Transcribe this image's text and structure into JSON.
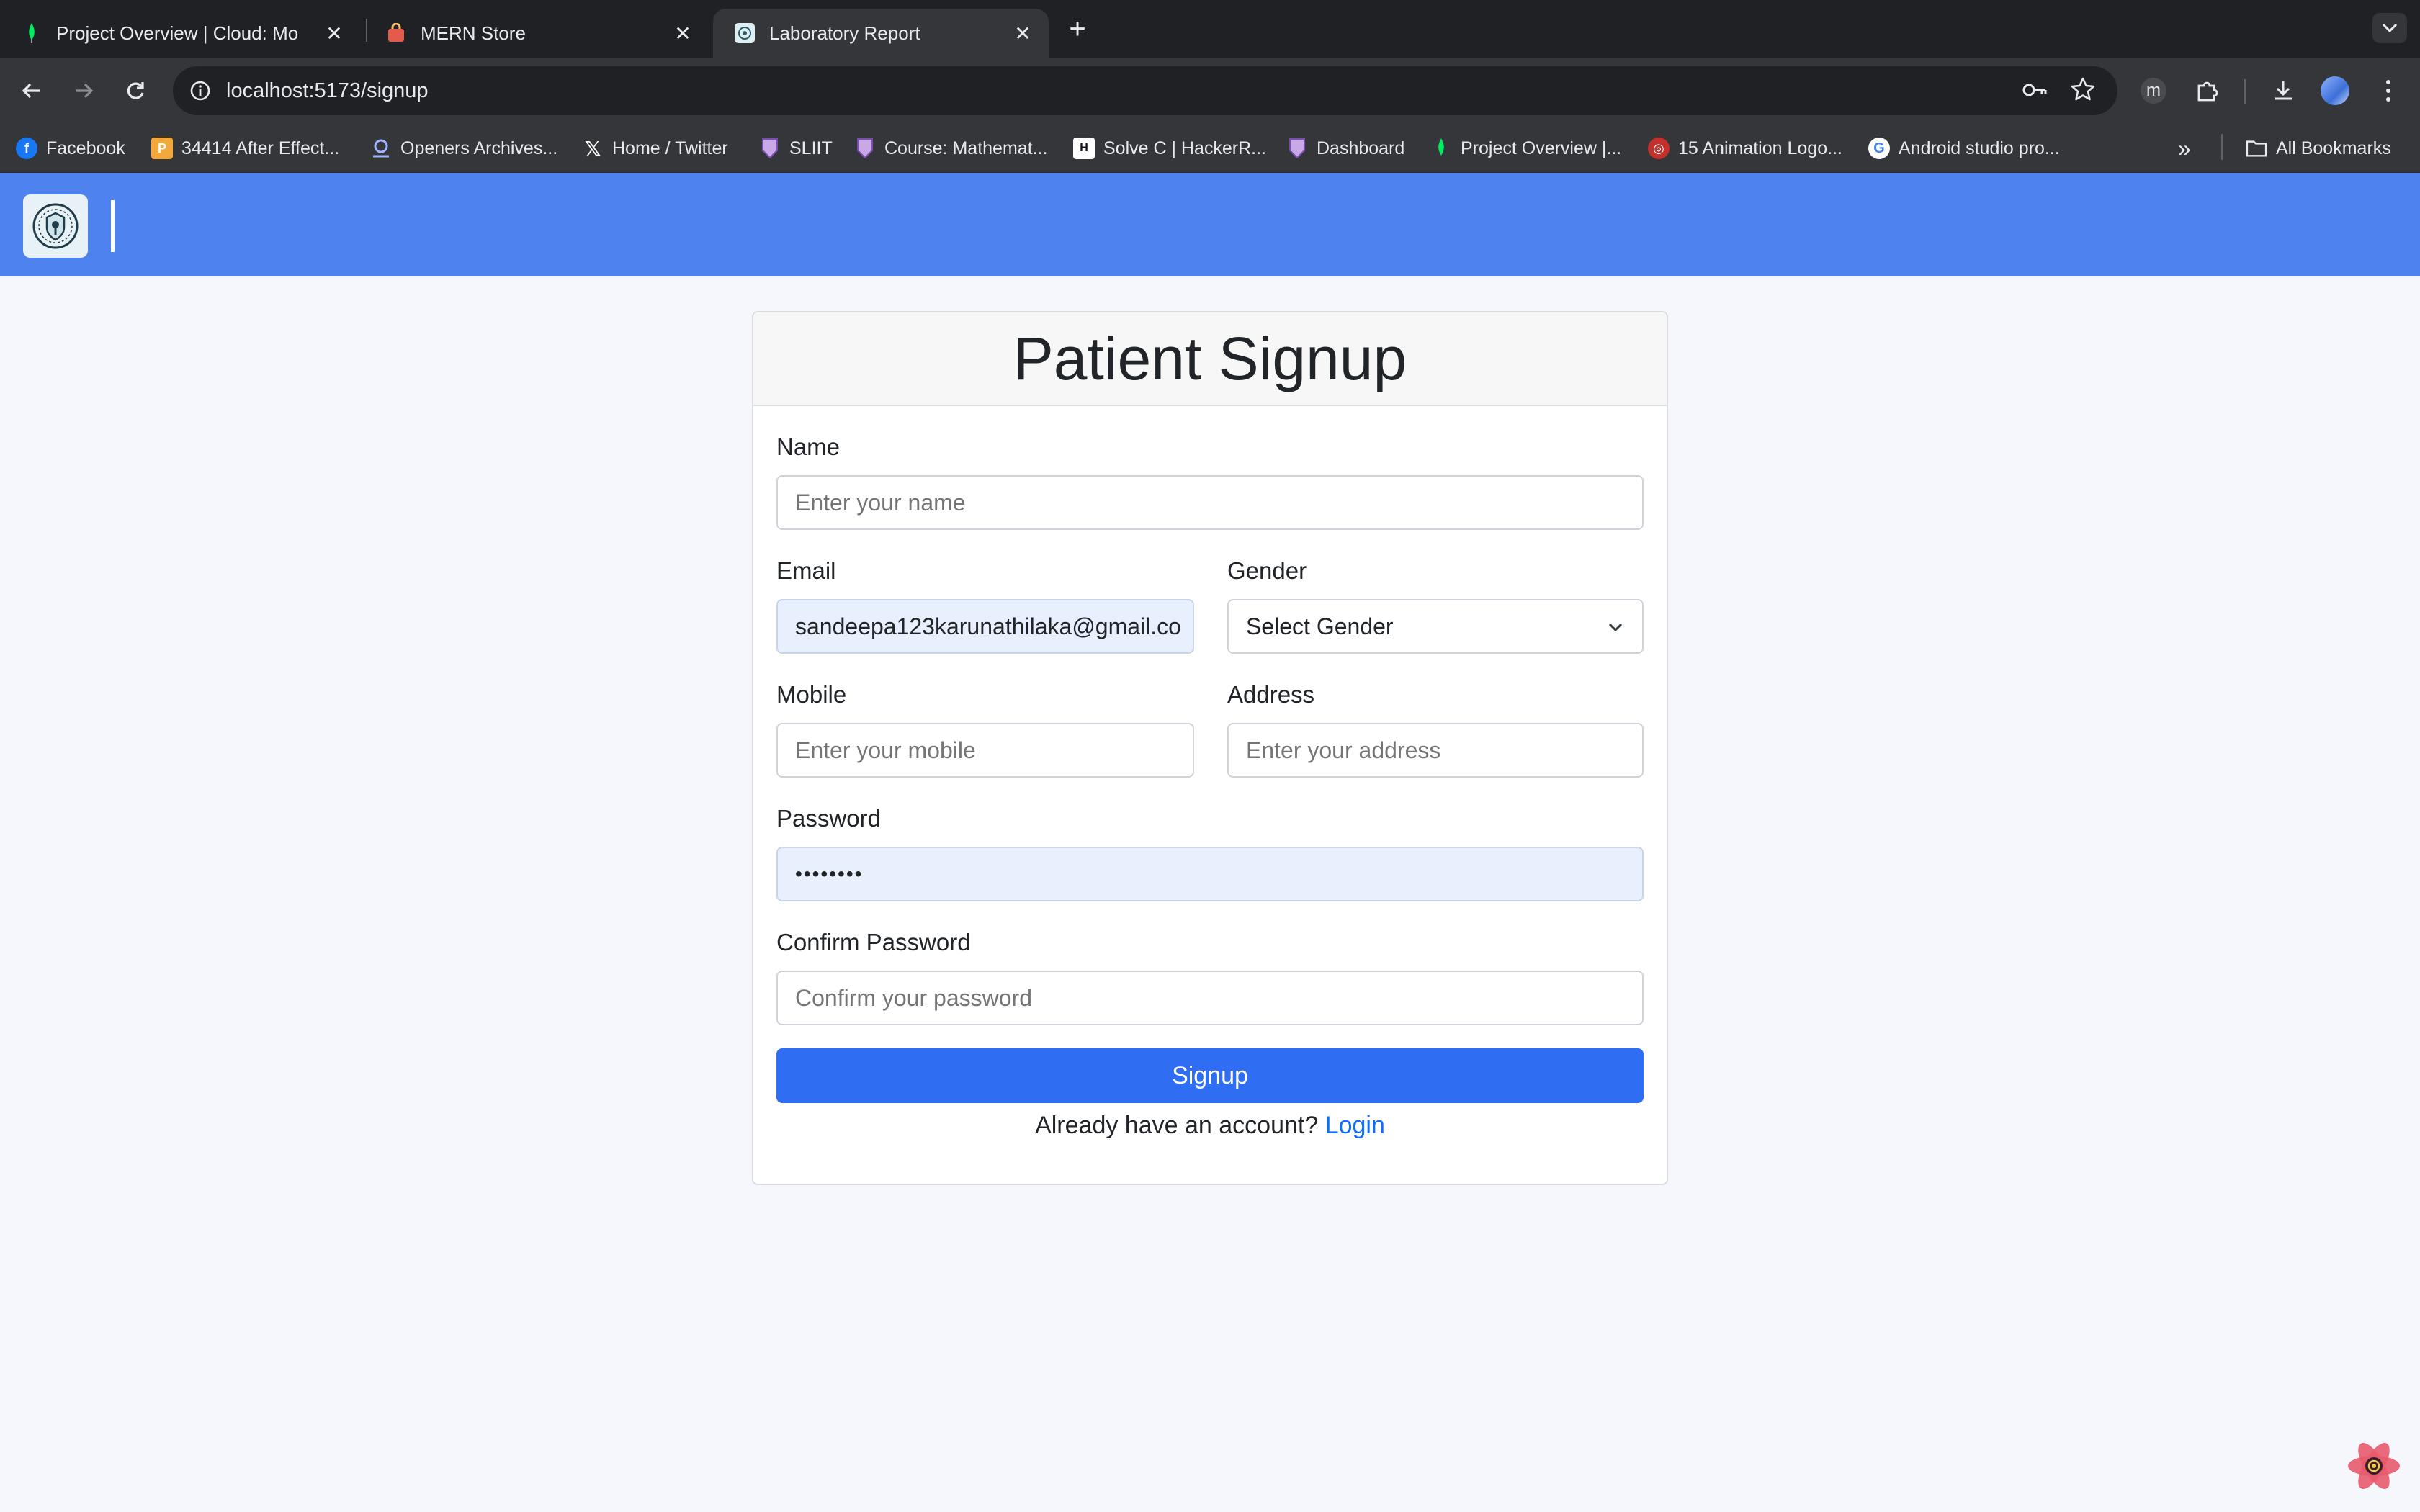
{
  "browser": {
    "tabs": [
      {
        "title": "Project Overview | Cloud: Mo",
        "active": false
      },
      {
        "title": "MERN Store",
        "active": false
      },
      {
        "title": "Laboratory Report",
        "active": true
      }
    ],
    "url": "localhost:5173/signup",
    "bookmarks": [
      "Facebook",
      "34414 After Effect...",
      "Openers Archives...",
      "Home / Twitter",
      "SLIIT",
      "Course: Mathemat...",
      "Solve C | HackerR...",
      "Dashboard",
      "Project Overview |...",
      "15 Animation Logo...",
      "Android studio pro..."
    ],
    "all_bookmarks": "All Bookmarks",
    "profile_letter": "m"
  },
  "form": {
    "title": "Patient Signup",
    "name": {
      "label": "Name",
      "placeholder": "Enter your name",
      "value": ""
    },
    "email": {
      "label": "Email",
      "value": "sandeepa123karunathilaka@gmail.co"
    },
    "gender": {
      "label": "Gender",
      "selected": "Select Gender"
    },
    "mobile": {
      "label": "Mobile",
      "placeholder": "Enter your mobile"
    },
    "address": {
      "label": "Address",
      "placeholder": "Enter your address"
    },
    "password": {
      "label": "Password",
      "value": "••••••••"
    },
    "confirm": {
      "label": "Confirm Password",
      "placeholder": "Confirm your password"
    },
    "submit_label": "Signup",
    "footer_text": "Already have an account?",
    "login_link": "Login"
  },
  "colors": {
    "appbar": "#4e82ef",
    "primary_button": "#2f6ef2",
    "link": "#0d6efd",
    "autofill_bg": "#e8f0fe"
  }
}
